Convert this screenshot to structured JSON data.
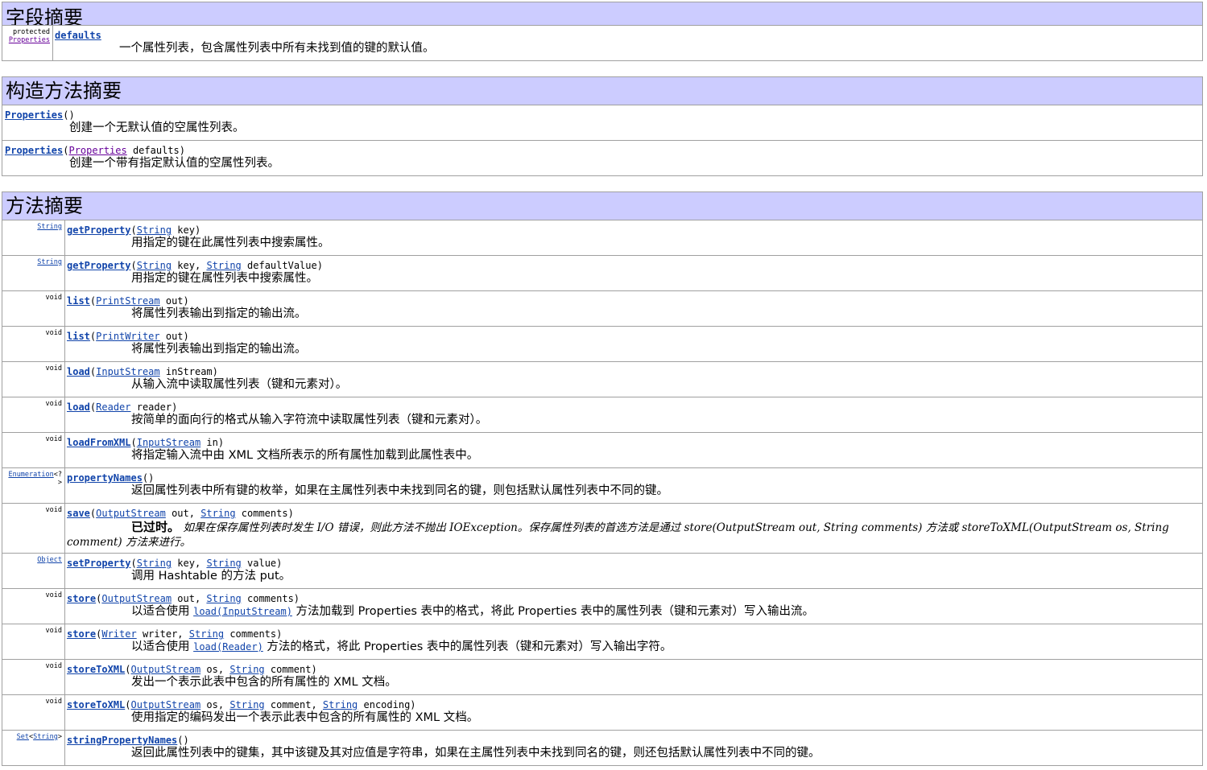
{
  "field_summary": {
    "title": "字段摘要",
    "rows": [
      {
        "type_line1": "protected",
        "type_line2": "Properties",
        "name": "defaults",
        "desc": "一个属性列表，包含属性列表中所有未找到值的键的默认值。"
      }
    ]
  },
  "constructor_summary": {
    "title": "构造方法摘要",
    "rows": [
      {
        "name": "Properties",
        "params_text": "()",
        "desc": "创建一个无默认值的空属性列表。"
      },
      {
        "name": "Properties",
        "open": "(",
        "param_type": "Properties",
        "param_rest": " defaults)",
        "desc": "创建一个带有指定默认值的空属性列表。"
      }
    ]
  },
  "method_summary": {
    "title": "方法摘要",
    "rows": [
      {
        "type": "String",
        "name": "getProperty",
        "p1_type": "String",
        "p1_name": " key)",
        "desc": "用指定的键在此属性列表中搜索属性。"
      },
      {
        "type": "String",
        "name": "getProperty",
        "p1_type": "String",
        "p1_name": " key, ",
        "p2_type": "String",
        "p2_name": " defaultValue)",
        "desc": "用指定的键在属性列表中搜索属性。"
      },
      {
        "type": "void",
        "name": "list",
        "p1_type": "PrintStream",
        "p1_name": " out)",
        "desc": "将属性列表输出到指定的输出流。"
      },
      {
        "type": "void",
        "name": "list",
        "p1_type": "PrintWriter",
        "p1_name": " out)",
        "desc": "将属性列表输出到指定的输出流。"
      },
      {
        "type": "void",
        "name": "load",
        "p1_type": "InputStream",
        "p1_name": " inStream)",
        "desc": "从输入流中读取属性列表（键和元素对）。"
      },
      {
        "type": "void",
        "name": "load",
        "p1_type": "Reader",
        "p1_name": " reader)",
        "desc": "按简单的面向行的格式从输入字符流中读取属性列表（键和元素对）。"
      },
      {
        "type": "void",
        "name": "loadFromXML",
        "p1_type": "InputStream",
        "p1_name": " in)",
        "desc": "将指定输入流中由 XML 文档所表示的所有属性加载到此属性表中。"
      },
      {
        "type_link": "Enumeration",
        "type_rest1": "<?",
        "type_rest2": ">",
        "name": "propertyNames",
        "params_text": "()",
        "desc": "返回属性列表中所有键的枚举，如果在主属性列表中未找到同名的键，则包括默认属性列表中不同的键。"
      },
      {
        "type": "void",
        "name": "save",
        "p1_type": "OutputStream",
        "p1_name": " out, ",
        "p2_type": "String",
        "p2_name": " comments)",
        "deprecated_label": "已过时。",
        "deprecated_text": "如果在保存属性列表时发生 I/O 错误，则此方法不抛出 IOException。保存属性列表的首选方法是通过 store(OutputStream out, String comments) 方法或 storeToXML(OutputStream os, String comment) 方法来进行。"
      },
      {
        "type": "Object",
        "name": "setProperty",
        "p1_type": "String",
        "p1_name": " key, ",
        "p2_type": "String",
        "p2_name": " value)",
        "desc": "调用 Hashtable 的方法 put。"
      },
      {
        "type": "void",
        "name": "store",
        "p1_type": "OutputStream",
        "p1_name": " out, ",
        "p2_type": "String",
        "p2_name": " comments)",
        "desc_pre": "以适合使用 ",
        "desc_link": "load(InputStream)",
        "desc_post": " 方法加载到 Properties 表中的格式，将此 Properties 表中的属性列表（键和元素对）写入输出流。"
      },
      {
        "type": "void",
        "name": "store",
        "p1_type": "Writer",
        "p1_name": " writer, ",
        "p2_type": "String",
        "p2_name": " comments)",
        "desc_pre": "以适合使用 ",
        "desc_link": "load(Reader)",
        "desc_post": " 方法的格式，将此 Properties 表中的属性列表（键和元素对）写入输出字符。"
      },
      {
        "type": "void",
        "name": "storeToXML",
        "p1_type": "OutputStream",
        "p1_name": " os, ",
        "p2_type": "String",
        "p2_name": " comment)",
        "desc": "发出一个表示此表中包含的所有属性的 XML 文档。"
      },
      {
        "type": "void",
        "name": "storeToXML",
        "p1_type": "OutputStream",
        "p1_name": " os, ",
        "p2_type": "String",
        "p2_name": " comment, ",
        "p3_type": "String",
        "p3_name": " encoding)",
        "desc": "使用指定的编码发出一个表示此表中包含的所有属性的 XML 文档。"
      },
      {
        "type_link": "Set",
        "type_rest1": "<",
        "type_link2": "String",
        "type_rest2": ">",
        "name": "stringPropertyNames",
        "params_text": "()",
        "desc": "返回此属性列表中的键集，其中该键及其对应值是字符串，如果在主属性列表中未找到同名的键，则还包括默认属性列表中不同的键。"
      }
    ]
  }
}
